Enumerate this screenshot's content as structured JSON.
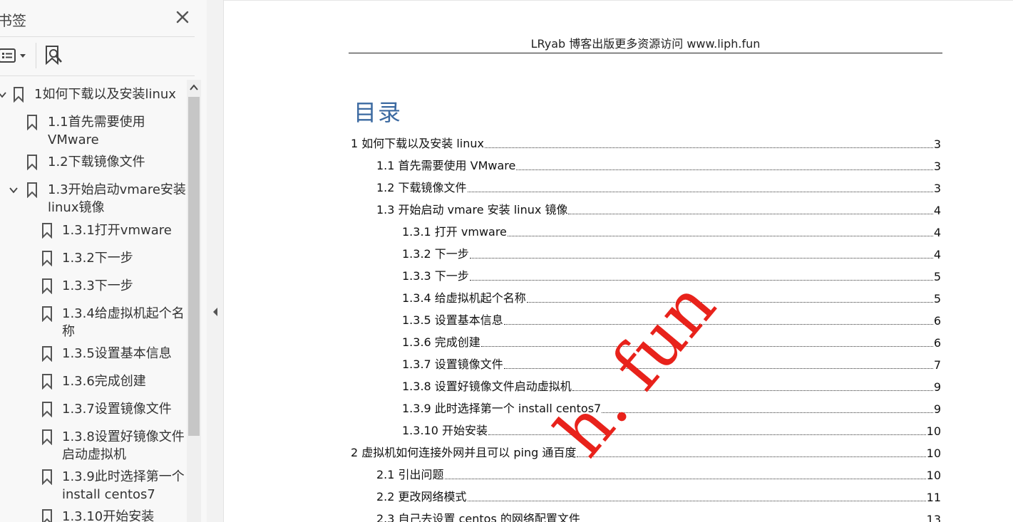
{
  "bookmarks_panel": {
    "title": "书签",
    "close_icon": "close-icon",
    "toolbar": {
      "options_icon": "list-options-icon",
      "find_icon": "find-bookmark-icon"
    },
    "items": [
      {
        "label": "1如何下载以及安装linux",
        "level": 0,
        "expanded": true,
        "lines": [
          "1如何下载以及安装linux"
        ]
      },
      {
        "label": "1.1首先需要使用VMware",
        "level": 1,
        "lines": [
          "1.1首先需要使用",
          "VMware"
        ]
      },
      {
        "label": "1.2下载镜像文件",
        "level": 1,
        "lines": [
          "1.2下载镜像文件"
        ]
      },
      {
        "label": "1.3开始启动vmare安装linux镜像",
        "level": 1,
        "expanded": true,
        "lines": [
          "1.3开始启动vmare安装",
          "linux镜像"
        ]
      },
      {
        "label": "1.3.1打开vmware",
        "level": 2,
        "lines": [
          "1.3.1打开vmware"
        ]
      },
      {
        "label": "1.3.2下一步",
        "level": 2,
        "lines": [
          "1.3.2下一步"
        ]
      },
      {
        "label": "1.3.3下一步",
        "level": 2,
        "lines": [
          "1.3.3下一步"
        ]
      },
      {
        "label": "1.3.4给虚拟机起个名称",
        "level": 2,
        "lines": [
          "1.3.4给虚拟机起个名",
          "称"
        ]
      },
      {
        "label": "1.3.5设置基本信息",
        "level": 2,
        "lines": [
          "1.3.5设置基本信息"
        ]
      },
      {
        "label": "1.3.6完成创建",
        "level": 2,
        "lines": [
          "1.3.6完成创建"
        ]
      },
      {
        "label": "1.3.7设置镜像文件",
        "level": 2,
        "lines": [
          "1.3.7设置镜像文件"
        ]
      },
      {
        "label": "1.3.8设置好镜像文件启动虚拟机",
        "level": 2,
        "lines": [
          "1.3.8设置好镜像文件",
          "启动虚拟机"
        ]
      },
      {
        "label": "1.3.9此时选择第一个install centos7",
        "level": 2,
        "lines": [
          "1.3.9此时选择第一个",
          "install centos7"
        ]
      },
      {
        "label": "1.3.10开始安装",
        "level": 2,
        "lines": [
          "1.3.10开始安装"
        ]
      }
    ]
  },
  "document": {
    "header": "LRyab 博客出版更多资源访问 www.liph.fun",
    "toc_title": "目录",
    "toc": [
      {
        "text": "1 如何下载以及安装 linux",
        "page": "3",
        "level": 0
      },
      {
        "text": "1.1 首先需要使用 VMware",
        "page": "3",
        "level": 1
      },
      {
        "text": "1.2 下载镜像文件",
        "page": "3",
        "level": 1
      },
      {
        "text": "1.3 开始启动 vmare 安装 linux 镜像",
        "page": "4",
        "level": 1
      },
      {
        "text": "1.3.1 打开 vmware",
        "page": "4",
        "level": 2
      },
      {
        "text": "1.3.2 下一步",
        "page": "4",
        "level": 2
      },
      {
        "text": "1.3.3 下一步",
        "page": "5",
        "level": 2
      },
      {
        "text": "1.3.4 给虚拟机起个名称",
        "page": "5",
        "level": 2
      },
      {
        "text": "1.3.5 设置基本信息",
        "page": "6",
        "level": 2
      },
      {
        "text": "1.3.6 完成创建",
        "page": "6",
        "level": 2
      },
      {
        "text": "1.3.7 设置镜像文件",
        "page": "7",
        "level": 2
      },
      {
        "text": "1.3.8 设置好镜像文件启动虚拟机",
        "page": "9",
        "level": 2
      },
      {
        "text": "1.3.9 此时选择第一个 install centos7",
        "page": "9",
        "level": 2
      },
      {
        "text": "1.3.10 开始安装",
        "page": "10",
        "level": 2
      },
      {
        "text": "2 虚拟机如何连接外网并且可以 ping  通百度",
        "page": "10",
        "level": 0
      },
      {
        "text": "2.1 引出问题",
        "page": "10",
        "level": 1
      },
      {
        "text": "2.2 更改网络模式",
        "page": "11",
        "level": 1
      },
      {
        "text": "2.3 自己去设置 centos 的网络配置文件",
        "page": "13",
        "level": 1
      }
    ],
    "watermark": "h. fun",
    "watermark_color": "#e8221b",
    "title_color": "#3c6aa1"
  }
}
